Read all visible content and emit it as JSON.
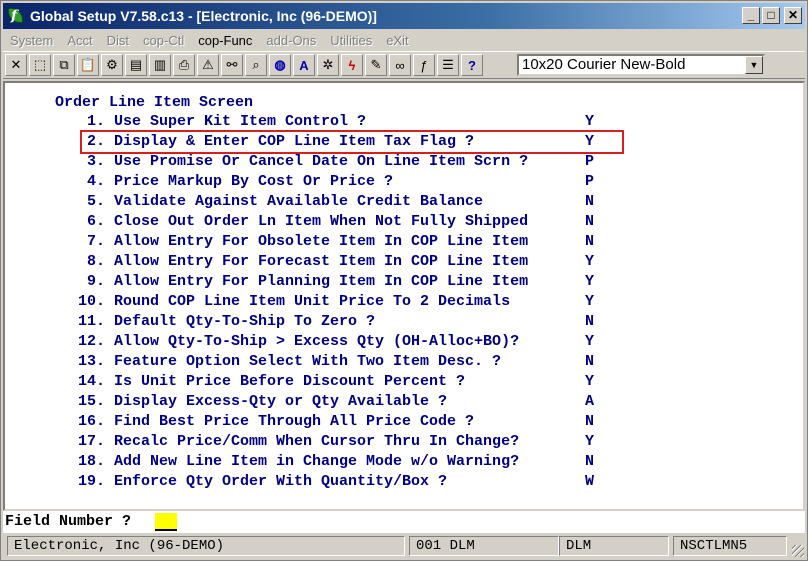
{
  "window": {
    "title": "Global Setup V7.58.c13 - [Electronic, Inc (96-DEMO)]",
    "buttons": {
      "minimize": "_",
      "maximize": "□",
      "close": "✕"
    }
  },
  "menu": [
    "System",
    "Acct",
    "Dist",
    "cop-Ctl",
    "cop-Func",
    "add-Ons",
    "Utilities",
    "eXit"
  ],
  "toolbar": {
    "font_select": "10x20 Courier New-Bold"
  },
  "screen": {
    "title": "Order Line Item Screen",
    "items": [
      {
        "num": "1.",
        "text": "Use Super Kit Item Control ?",
        "value": "Y"
      },
      {
        "num": "2.",
        "text": "Display & Enter COP Line Item Tax Flag ?",
        "value": "Y"
      },
      {
        "num": "3.",
        "text": "Use Promise Or Cancel Date On Line Item Scrn ?",
        "value": "P"
      },
      {
        "num": "4.",
        "text": "Price Markup By Cost Or Price ?",
        "value": "P"
      },
      {
        "num": "5.",
        "text": "Validate Against Available Credit Balance",
        "value": "N"
      },
      {
        "num": "6.",
        "text": "Close Out Order Ln Item When Not Fully Shipped",
        "value": "N"
      },
      {
        "num": "7.",
        "text": "Allow Entry For Obsolete Item In COP Line Item",
        "value": "N"
      },
      {
        "num": "8.",
        "text": "Allow Entry For Forecast Item In COP Line Item",
        "value": "Y"
      },
      {
        "num": "9.",
        "text": "Allow Entry For Planning Item In COP Line Item",
        "value": "Y"
      },
      {
        "num": "10.",
        "text": "Round COP Line Item Unit Price To 2 Decimals",
        "value": "Y"
      },
      {
        "num": "11.",
        "text": "Default Qty-To-Ship To Zero ?",
        "value": "N"
      },
      {
        "num": "12.",
        "text": "Allow Qty-To-Ship > Excess Qty (OH-Alloc+BO)?",
        "value": "Y"
      },
      {
        "num": "13.",
        "text": "Feature Option Select With Two Item Desc. ?",
        "value": "N"
      },
      {
        "num": "14.",
        "text": "Is Unit Price Before Discount Percent ?",
        "value": "Y"
      },
      {
        "num": "15.",
        "text": "Display Excess-Qty or Qty Available ?",
        "value": "A"
      },
      {
        "num": "16.",
        "text": "Find Best Price Through All Price Code ?",
        "value": "N"
      },
      {
        "num": "17.",
        "text": "Recalc Price/Comm When Cursor Thru In Change?",
        "value": "Y"
      },
      {
        "num": "18.",
        "text": "Add New Line Item in Change Mode w/o Warning?",
        "value": "N"
      },
      {
        "num": "19.",
        "text": "Enforce Qty Order With Quantity/Box ?",
        "value": "W"
      }
    ]
  },
  "field_prompt": "Field Number ?",
  "status": {
    "company": "Electronic, Inc (96-DEMO)",
    "user_code": "001 DLM",
    "user": "DLM",
    "program": "NSCTLMN5"
  }
}
